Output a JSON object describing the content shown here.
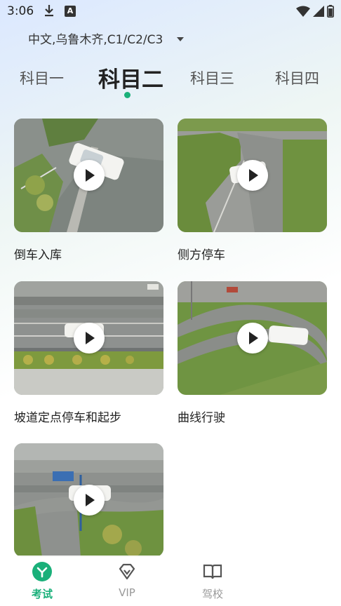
{
  "status_bar": {
    "time": "3:06",
    "icons": [
      "download-icon",
      "a-notification-icon",
      "wifi-icon",
      "signal-icon",
      "battery-icon"
    ]
  },
  "license": {
    "label": "中文,乌鲁木齐,C1/C2/C3"
  },
  "tabs": [
    {
      "label": "科目一",
      "active": false
    },
    {
      "label": "科目二",
      "active": true
    },
    {
      "label": "科目三",
      "active": false
    },
    {
      "label": "科目四",
      "active": false
    }
  ],
  "videos": [
    {
      "title": "倒车入库",
      "icon": "play-icon"
    },
    {
      "title": "侧方停车",
      "icon": "play-icon"
    },
    {
      "title": "坡道定点停车和起步",
      "icon": "play-icon"
    },
    {
      "title": "曲线行驶",
      "icon": "play-icon"
    },
    {
      "title": "",
      "icon": "play-icon"
    }
  ],
  "bottom_nav": [
    {
      "label": "考试",
      "icon": "exam-icon",
      "active": true
    },
    {
      "label": "VIP",
      "icon": "vip-diamond-icon",
      "active": false
    },
    {
      "label": "驾校",
      "icon": "book-icon",
      "active": false
    }
  ],
  "colors": {
    "accent": "#1ab07a",
    "inactive": "#999999"
  }
}
